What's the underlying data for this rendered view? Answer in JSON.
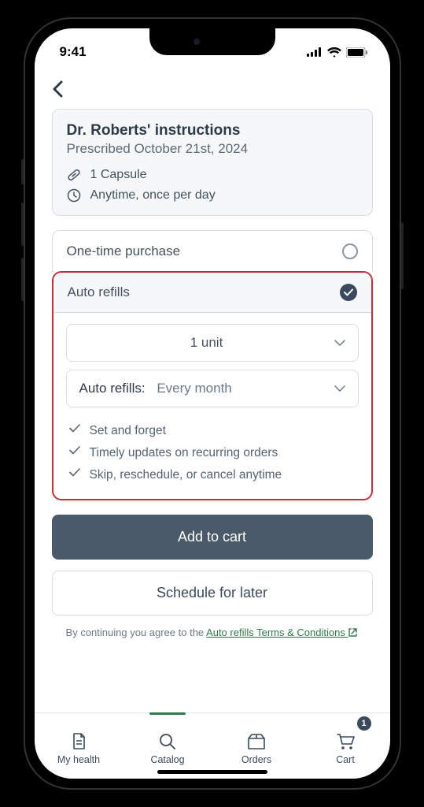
{
  "status": {
    "time": "9:41"
  },
  "instructions": {
    "title": "Dr. Roberts' instructions",
    "prescribed": "Prescribed October 21st, 2024",
    "dose": "1 Capsule",
    "frequency": "Anytime, once per day"
  },
  "purchase_options": {
    "one_time": "One-time purchase",
    "auto_refills": "Auto refills"
  },
  "auto_refills": {
    "units_label": "1 unit",
    "frequency_label": "Auto refills:",
    "frequency_value": "Every month",
    "benefits": [
      "Set and forget",
      "Timely updates on recurring orders",
      "Skip, reschedule, or cancel anytime"
    ]
  },
  "buttons": {
    "add_to_cart": "Add to cart",
    "schedule": "Schedule for later"
  },
  "legal": {
    "prefix": "By continuing you agree to the ",
    "link": "Auto refills Terms & Conditions"
  },
  "tabs": {
    "my_health": "My health",
    "catalog": "Catalog",
    "orders": "Orders",
    "cart": "Cart",
    "cart_count": "1"
  }
}
